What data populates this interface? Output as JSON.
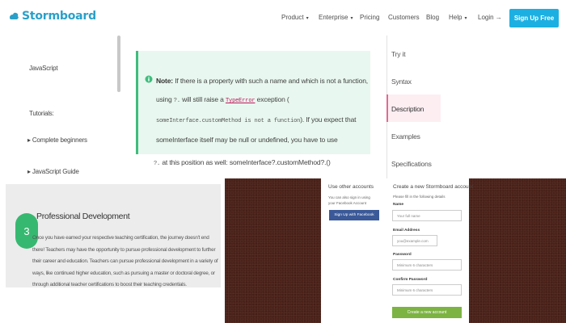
{
  "brand": {
    "name": "Stormboard",
    "accent": "#1cb0e2"
  },
  "nav": {
    "items": [
      {
        "label": "Product",
        "caret": "▾"
      },
      {
        "label": "Enterprise",
        "caret": "▾"
      },
      {
        "label": "Pricing",
        "caret": ""
      },
      {
        "label": "Customers",
        "caret": ""
      },
      {
        "label": "Blog",
        "caret": ""
      },
      {
        "label": "Help",
        "caret": "▾"
      },
      {
        "label": "Login →",
        "caret": ""
      }
    ],
    "signup": "Sign Up Free"
  },
  "sidebar": {
    "heading": "JavaScript",
    "tutorials_label": "Tutorials:",
    "items": [
      "Complete beginners",
      "JavaScript Guide"
    ],
    "bullet": "▸"
  },
  "note": {
    "bold": "Note:",
    "text1": "If there is a property with such a name and which is not a function, using",
    "code1": "?.",
    "text2": "will still raise a",
    "code2": "TypeError",
    "text3": "exception (",
    "code3": "someInterface.customMethod is not a function",
    "text4": "). If you expect that someInterface itself may be null or undefined, you have to use",
    "code4": "?.",
    "text5": "at this position as well:",
    "code5": "someInterface?.customMethod?.()",
    "accent": "#3fbd7d"
  },
  "right_nav": {
    "items": [
      "Try it",
      "Syntax",
      "Description",
      "Examples",
      "Specifications"
    ],
    "active": "Description",
    "active_color": "#e06a90"
  },
  "card": {
    "number": "3",
    "title": "Professional Development",
    "text": "Once you have earned your respective teaching certification, the journey doesn't end there! Teachers may have the opportunity to pursue professional development to further their career and education. Teachers can pursue professional development in a variety of ways, like continued higher education, such as pursuing a master or doctoral degree, or through additional teacher certifications to boost their teaching credentials."
  },
  "forms": {
    "left_title": "Use other accounts",
    "left_desc": "You can also sign in using your Facebook Account",
    "fb_button": "Sign Up with Facebook",
    "right_title": "Create a new Stormboard account",
    "right_desc": "Please fill in the following details",
    "fields": [
      {
        "label": "Name",
        "placeholder": "Your full name"
      },
      {
        "label": "Email Address",
        "placeholder": "you@example.com"
      },
      {
        "label": "Password",
        "placeholder": "Minimum 6 characters"
      },
      {
        "label": "Confirm Password",
        "placeholder": "Minimum 6 characters"
      }
    ],
    "create_button": "Create a new account"
  }
}
